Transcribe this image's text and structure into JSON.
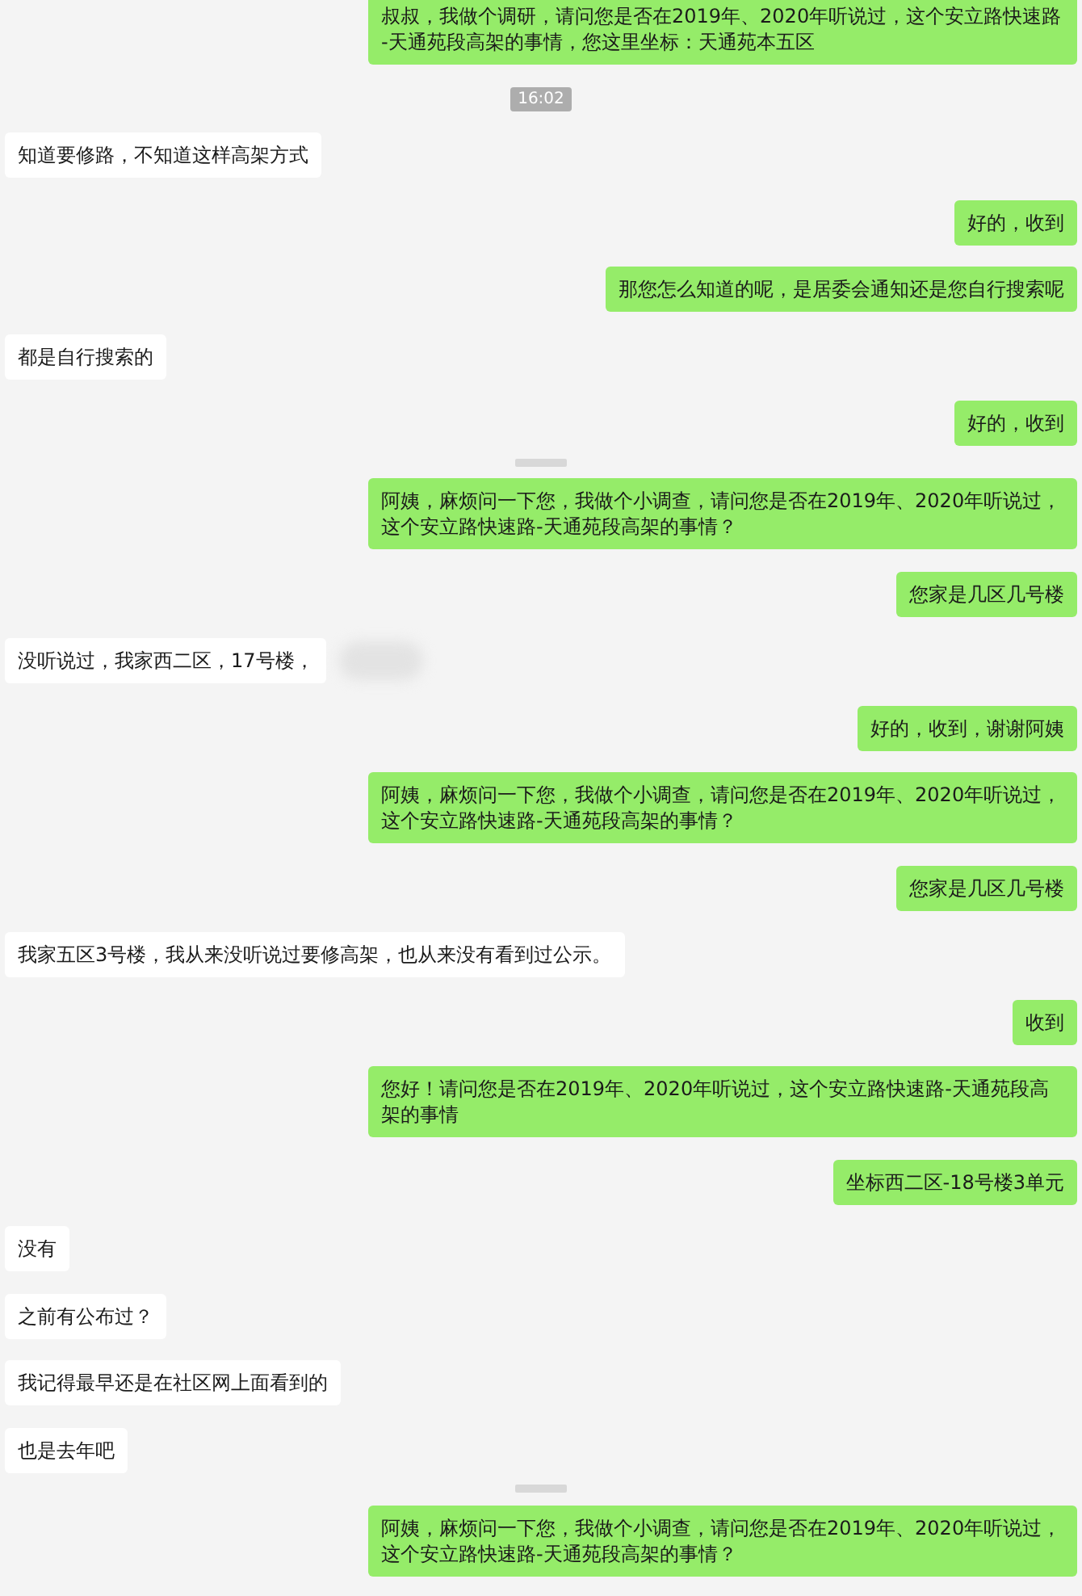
{
  "messages": [
    {
      "kind": "sent",
      "text": "叔叔，我做个调研，请问您是否在2019年、2020年听说过，这个安立路快速路-天通苑段高架的事情，您这里坐标：天通苑本五区"
    },
    {
      "kind": "time",
      "text": "16:02"
    },
    {
      "kind": "received",
      "text": "知道要修路，不知道这样高架方式",
      "redacted": false
    },
    {
      "kind": "sent",
      "text": "好的，收到"
    },
    {
      "kind": "sent",
      "text": "那您怎么知道的呢，是居委会通知还是您自行搜索呢"
    },
    {
      "kind": "received",
      "text": "都是自行搜索的",
      "redacted": false
    },
    {
      "kind": "sent",
      "text": "好的，收到"
    },
    {
      "kind": "blurred_time"
    },
    {
      "kind": "sent",
      "text": "阿姨，麻烦问一下您，我做个小调查，请问您是否在2019年、2020年听说过，这个安立路快速路-天通苑段高架的事情？"
    },
    {
      "kind": "sent",
      "text": "您家是几区几号楼"
    },
    {
      "kind": "received",
      "text": "没听说过，我家西二区，17号楼，",
      "redacted": true
    },
    {
      "kind": "sent",
      "text": "好的，收到，谢谢阿姨"
    },
    {
      "kind": "sent",
      "text": "阿姨，麻烦问一下您，我做个小调查，请问您是否在2019年、2020年听说过，这个安立路快速路-天通苑段高架的事情？"
    },
    {
      "kind": "sent",
      "text": "您家是几区几号楼"
    },
    {
      "kind": "received",
      "text": "我家五区3号楼，我从来没听说过要修高架，也从来没有看到过公示。",
      "redacted": false
    },
    {
      "kind": "sent",
      "text": "收到"
    },
    {
      "kind": "sent",
      "text": "您好！请问您是否在2019年、2020年听说过，这个安立路快速路-天通苑段高架的事情"
    },
    {
      "kind": "sent",
      "text": "坐标西二区-18号楼3单元"
    },
    {
      "kind": "received",
      "text": "没有",
      "redacted": false
    },
    {
      "kind": "received",
      "text": "之前有公布过？",
      "redacted": false
    },
    {
      "kind": "received",
      "text": "我记得最早还是在社区网上面看到的",
      "redacted": false
    },
    {
      "kind": "received",
      "text": "也是去年吧",
      "redacted": false
    },
    {
      "kind": "blurred_time"
    },
    {
      "kind": "sent",
      "text": "阿姨，麻烦问一下您，我做个小调查，请问您是否在2019年、2020年听说过，这个安立路快速路-天通苑段高架的事情？"
    }
  ]
}
